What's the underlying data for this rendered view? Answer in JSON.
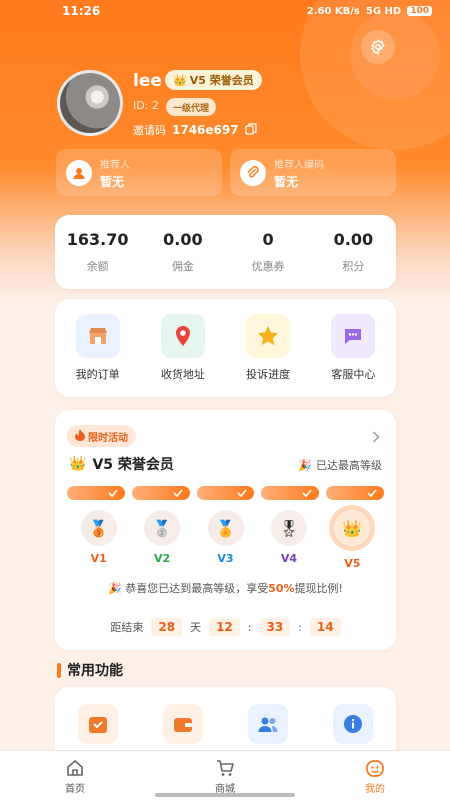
{
  "status_bar": {
    "time": "11:26",
    "network_speed": "2.60 KB/s",
    "signal": "5G HD",
    "battery": "100"
  },
  "profile": {
    "username": "lee",
    "vip_label": "V5 荣誉会员",
    "id_label": "ID: 2",
    "agent_level": "一级代理",
    "invite_label": "邀请码",
    "invite_code": "1746e697"
  },
  "referrer": {
    "label": "推荐人",
    "value": "暂无"
  },
  "referrer_code": {
    "label": "推荐人编码",
    "value": "暂无"
  },
  "stats": [
    {
      "value": "163.70",
      "label": "余额"
    },
    {
      "value": "0.00",
      "label": "佣金"
    },
    {
      "value": "0",
      "label": "优惠券"
    },
    {
      "value": "0.00",
      "label": "积分"
    }
  ],
  "menu": [
    {
      "label": "我的订单",
      "icon": "store-icon",
      "bg": "#eaf2ff"
    },
    {
      "label": "收货地址",
      "icon": "location-pin-icon",
      "bg": "#e4f6ee"
    },
    {
      "label": "投诉进度",
      "icon": "star-icon",
      "bg": "#fff6dc"
    },
    {
      "label": "客服中心",
      "icon": "chat-bubble-icon",
      "bg": "#f1eaff"
    }
  ],
  "activity": {
    "badge": "限时活动",
    "title": "V5 荣誉会员",
    "level_status": "已达最高等级",
    "levels": [
      {
        "name": "V1",
        "color": "#e8611c"
      },
      {
        "name": "V2",
        "color": "#2aa84a"
      },
      {
        "name": "V3",
        "color": "#1c8bd6"
      },
      {
        "name": "V4",
        "color": "#7b3fc4"
      },
      {
        "name": "V5",
        "color": "#e8611c"
      }
    ],
    "congrats_prefix": "恭喜您已达到最高等级，享受",
    "congrats_highlight": "50%",
    "congrats_suffix": "提现比例!",
    "countdown_label": "距结束",
    "days": "28",
    "days_unit": "天",
    "hours": "12",
    "minutes": "33",
    "seconds": "14",
    "sep": ":"
  },
  "common_functions": {
    "title": "常用功能",
    "items": [
      {
        "icon": "calendar-check-icon",
        "bg": "#fff0e4"
      },
      {
        "icon": "wallet-icon",
        "bg": "#fff0e4"
      },
      {
        "icon": "team-icon",
        "bg": "#eaf2ff"
      },
      {
        "icon": "info-icon",
        "bg": "#eaf2ff"
      }
    ]
  },
  "tabbar": [
    {
      "label": "首页",
      "icon": "home-icon"
    },
    {
      "label": "商城",
      "icon": "cart-icon"
    },
    {
      "label": "我的",
      "icon": "smiley-icon"
    }
  ],
  "colors": {
    "accent": "#ff7a1c",
    "accent_dark": "#e8611c",
    "background": "#fdf0e7"
  }
}
